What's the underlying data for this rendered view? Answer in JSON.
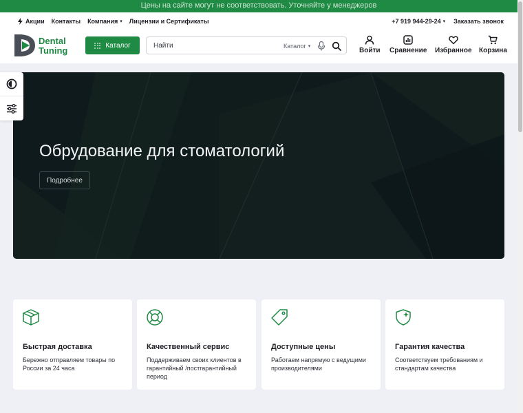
{
  "topbar": {
    "notice": "Цены на сайте могут не соответствовать. Уточняйте у менеджеров"
  },
  "header": {
    "links": [
      "Акции",
      "Контакты",
      "Компания",
      "Лицензии и Сертификаты"
    ],
    "phone": "+7 919 944-29-24",
    "callback": "Заказать звонок"
  },
  "logo": {
    "line1": "Dental",
    "line2": "Tuning"
  },
  "catalog_button": "Каталог",
  "search": {
    "placeholder": "Найти",
    "scope": "Каталог"
  },
  "actions": {
    "login": "Войти",
    "compare": "Сравнение",
    "favorites": "Избранное",
    "cart": "Корзина"
  },
  "hero": {
    "title": "Обрудование для стоматологий",
    "button": "Подробнее"
  },
  "features": [
    {
      "title": "Быстрая доставка",
      "text": "Бережно отправляем товары по России за 24 часа",
      "icon": "box-icon"
    },
    {
      "title": "Качественный сервис",
      "text": "Поддерживаем своих клиентов в гарантийный /постгарантийный период",
      "icon": "lifebuoy-icon"
    },
    {
      "title": "Доступные цены",
      "text": "Работаем напрямую с ведущими производителями",
      "icon": "price-tag-icon"
    },
    {
      "title": "Гарантия качества",
      "text": "Соответствуем требованиям и стандартам качества",
      "icon": "shield-star-icon"
    }
  ],
  "colors": {
    "brand": "#1e8a44",
    "hero_bg": "#0f1a1d",
    "page_bg": "#eef0f5"
  }
}
